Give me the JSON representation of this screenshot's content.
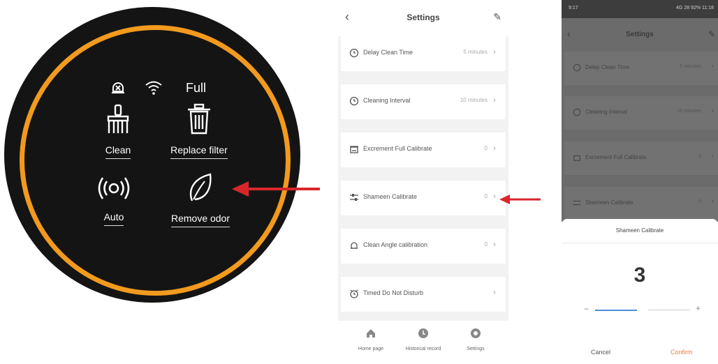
{
  "device_panel": {
    "status_text": "Full",
    "buttons": [
      {
        "label": "Clean",
        "icon": "brush-icon"
      },
      {
        "label": "Replace filter",
        "icon": "trash-icon"
      },
      {
        "label": "Auto",
        "icon": "broadcast-icon"
      },
      {
        "label": "Remove odor",
        "icon": "leaf-icon"
      }
    ],
    "colors": {
      "ring": "#f29a1e",
      "background": "#141414"
    }
  },
  "settings_screen": {
    "title": "Settings",
    "rows": [
      {
        "label": "Delay Clean Time",
        "value": "5 minutes"
      },
      {
        "label": "Cleaning Interval",
        "value": "10 minutes"
      },
      {
        "label": "Excrement Full Calibrate",
        "value": "0"
      },
      {
        "label": "Shameen Calibrate",
        "value": "0"
      },
      {
        "label": "Clean Angle calibration",
        "value": "0"
      },
      {
        "label": "Timed Do Not Disturb",
        "value": ""
      }
    ],
    "tabs": [
      {
        "label": "Home page",
        "icon": "home-icon"
      },
      {
        "label": "Historical record",
        "icon": "history-icon"
      },
      {
        "label": "Settings",
        "icon": "gear-icon"
      }
    ]
  },
  "calibrate_screen": {
    "status_bar": {
      "time": "9:17",
      "indicators": "4G 28 92% 11:18"
    },
    "title": "Settings",
    "rows": [
      {
        "label": "Delay Clean Time",
        "value": "5 minutes"
      },
      {
        "label": "Cleaning Interval",
        "value": "10 minutes"
      },
      {
        "label": "Excrement Full Calibrate",
        "value": "0"
      },
      {
        "label": "Shameen Calibrate",
        "value": "0"
      }
    ],
    "sheet": {
      "title": "Shameen Calibrate",
      "value": "3",
      "minus": "−",
      "plus": "+",
      "cancel": "Cancel",
      "confirm": "Confirm"
    },
    "colors": {
      "confirm": "#f07a3c",
      "slider": "#4a90d9"
    }
  },
  "annotations": {
    "arrow_color": "#d9262b"
  }
}
